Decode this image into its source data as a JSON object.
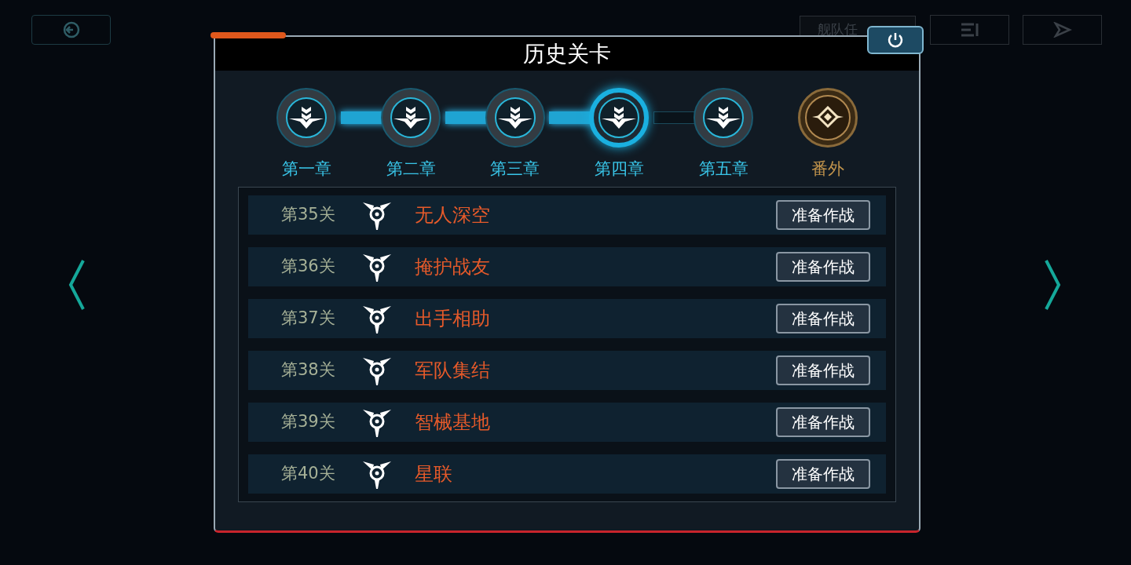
{
  "top_bar": {
    "fleet_button": "舰队任"
  },
  "dialog": {
    "title": "历史关卡"
  },
  "chapters": [
    {
      "label": "第一章",
      "kind": "chapter",
      "selected": false
    },
    {
      "label": "第二章",
      "kind": "chapter",
      "selected": false
    },
    {
      "label": "第三章",
      "kind": "chapter",
      "selected": false
    },
    {
      "label": "第四章",
      "kind": "chapter",
      "selected": true
    },
    {
      "label": "第五章",
      "kind": "chapter",
      "selected": false
    },
    {
      "label": "番外",
      "kind": "extra",
      "selected": false
    }
  ],
  "levels": [
    {
      "number": "第35关",
      "name": "无人深空",
      "action": "准备作战"
    },
    {
      "number": "第36关",
      "name": "掩护战友",
      "action": "准备作战"
    },
    {
      "number": "第37关",
      "name": "出手相助",
      "action": "准备作战"
    },
    {
      "number": "第38关",
      "name": "军队集结",
      "action": "准备作战"
    },
    {
      "number": "第39关",
      "name": "智械基地",
      "action": "准备作战"
    },
    {
      "number": "第40关",
      "name": "星联",
      "action": "准备作战"
    }
  ]
}
